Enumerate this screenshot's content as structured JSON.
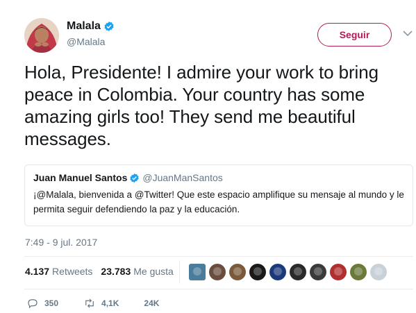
{
  "author": {
    "name": "Malala",
    "handle": "@Malala"
  },
  "follow_label": "Seguir",
  "tweet_text": "Hola, Presidente! I admire your work to bring peace in Colombia. Your country has some amazing girls too! They send me beautiful messages.",
  "quoted": {
    "name": "Juan Manuel Santos",
    "handle": "@JuanManSantos",
    "text": "¡@Malala, bienvenida a @Twitter! Que este espacio amplifique su mensaje al mundo y le permita seguir defendiendo la paz y la educación."
  },
  "timestamp": "7:49 - 9 jul. 2017",
  "stats": {
    "retweets_count": "4.137",
    "retweets_label": "Retweets",
    "likes_count": "23.783",
    "likes_label": "Me gusta"
  },
  "actions": {
    "replies": "350",
    "retweets": "4,1K",
    "likes": "24K"
  },
  "colors": {
    "accent": "#b31a56",
    "verified": "#1da1f2",
    "muted": "#657786"
  },
  "liker_avatar_colors": [
    "#4a7c9c",
    "#6a4e3d",
    "#7a5a3b",
    "#1a1a1a",
    "#1b3a7a",
    "#2a2a2a",
    "#3a3a3a",
    "#b03030",
    "#6b7a3a",
    "#c8d0d8"
  ]
}
